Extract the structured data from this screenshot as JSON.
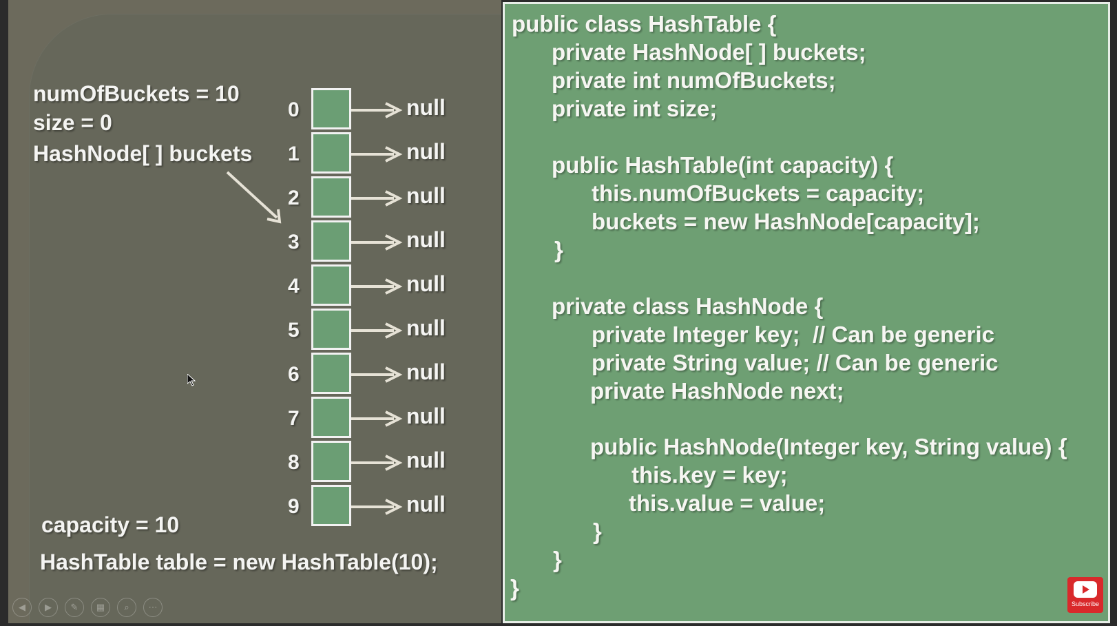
{
  "left_panel": {
    "num_of_buckets_text": "numOfBuckets = 10",
    "size_text": "size = 0",
    "buckets_label": "HashNode[ ] buckets",
    "capacity_text": "capacity = 10",
    "constructor_call": "HashTable table = new HashTable(10);",
    "buckets": [
      {
        "index": "0",
        "value": "null"
      },
      {
        "index": "1",
        "value": "null"
      },
      {
        "index": "2",
        "value": "null"
      },
      {
        "index": "3",
        "value": "null"
      },
      {
        "index": "4",
        "value": "null"
      },
      {
        "index": "5",
        "value": "null"
      },
      {
        "index": "6",
        "value": "null"
      },
      {
        "index": "7",
        "value": "null"
      },
      {
        "index": "8",
        "value": "null"
      },
      {
        "index": "9",
        "value": "null"
      }
    ]
  },
  "code_lines": [
    "public class HashTable {",
    "private HashNode[ ] buckets;",
    "private int numOfBuckets;",
    "private int size;",
    "public HashTable(int capacity) {",
    "this.numOfBuckets = capacity;",
    "buckets = new HashNode[capacity];",
    "}",
    "private class HashNode {",
    "private Integer key;  // Can be generic",
    "private String value; // Can be generic",
    "private HashNode next;",
    "public HashNode(Integer key, String value) {",
    "this.key = key;",
    "this.value = value;",
    "}",
    "}",
    "}"
  ],
  "subscribe": {
    "label": "Subscribe"
  },
  "colors": {
    "code_bg": "#6e9f73",
    "left_bg": "#66675a",
    "cell": "#6b9e74",
    "subscribe": "#d9292b"
  },
  "icons": [
    "prev-icon",
    "next-icon",
    "pen-icon",
    "slides-icon",
    "zoom-icon",
    "more-icon",
    "play-icon",
    "cursor-icon"
  ]
}
